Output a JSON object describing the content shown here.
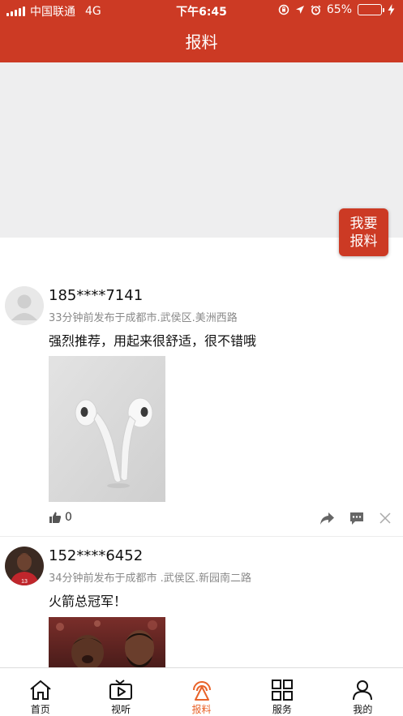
{
  "status_bar": {
    "carrier": "中国联通",
    "network": "4G",
    "time": "下午6:45",
    "battery": "65%",
    "battery_level": 0.65
  },
  "header": {
    "title": "报料"
  },
  "report_button": {
    "line1": "我要",
    "line2": "报料"
  },
  "posts": [
    {
      "username": "185****7141",
      "meta": "33分钟前发布于成都市.武侯区.美洲西路",
      "content": "强烈推荐，用起来很舒适，很不错哦",
      "likes": "0"
    },
    {
      "username": "152****6452",
      "meta": "34分钟前发布于成都市 .武侯区.新园南二路",
      "content": "火箭总冠军！"
    }
  ],
  "tabs": [
    {
      "label": "首页",
      "icon": "home-icon"
    },
    {
      "label": "视听",
      "icon": "tv-play-icon"
    },
    {
      "label": "报料",
      "icon": "report-broadcast-icon",
      "active": true
    },
    {
      "label": "服务",
      "icon": "grid-services-icon"
    },
    {
      "label": "我的",
      "icon": "user-profile-icon"
    }
  ],
  "colors": {
    "brand_red": "#cc3a24",
    "active_tab": "#e8632a",
    "battery_green": "#5fdc3b"
  }
}
